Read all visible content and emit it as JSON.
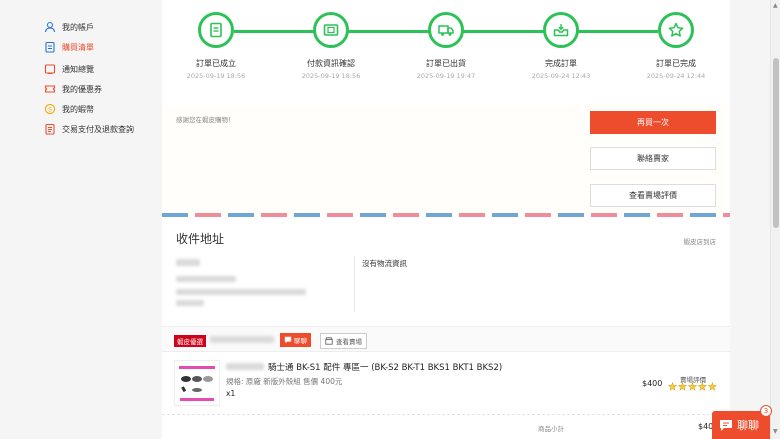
{
  "sidebar": {
    "items": [
      {
        "label": "我的帳戶",
        "icon": "user-icon"
      },
      {
        "label": "購買清單",
        "icon": "clipboard-icon",
        "active": true
      },
      {
        "label": "通知總覽",
        "icon": "bell-icon"
      },
      {
        "label": "我的優惠券",
        "icon": "ticket-icon"
      },
      {
        "label": "我的蝦幣",
        "icon": "coin-icon"
      },
      {
        "label": "交易支付及退款查詢",
        "icon": "document-icon"
      }
    ]
  },
  "steps": [
    {
      "label": "訂單已成立",
      "time": "2025-09-19 18:56",
      "icon": "receipt-icon"
    },
    {
      "label": "付款資訊確認",
      "time": "2025-09-19 18:56",
      "icon": "payment-icon"
    },
    {
      "label": "訂單已出貨",
      "time": "2025-09-19 19:47",
      "icon": "truck-icon"
    },
    {
      "label": "完成訂單",
      "time": "2025-09-24 12:43",
      "icon": "inbox-icon"
    },
    {
      "label": "訂單已完成",
      "time": "2025-09-24 12:44",
      "icon": "star-icon"
    }
  ],
  "thanks_text": "感謝您在蝦皮購物！",
  "buttons": {
    "buy_again": "再買一次",
    "contact_seller": "聯絡賣家",
    "view_rating": "查看賣場評價"
  },
  "address": {
    "title": "收件地址",
    "note": "蝦皮店到店",
    "logistics": "沒有物流資訊"
  },
  "shop": {
    "badge": "蝦皮優選",
    "chat_label": "聊聊",
    "view_shop_label": "查看賣場"
  },
  "product": {
    "name": "騎士通 BK-S1 配件 專區一 (BK-S2 BK-T1 BKS1 BKT1 BKS2)",
    "spec": "規格: 原廠 新版外殼組 售價 400元",
    "qty": "x1",
    "price": "$400",
    "rating_label": "賣場評價",
    "rating_stars": 5
  },
  "subtotal": {
    "label": "商品小計",
    "value": "$40"
  },
  "chat_float": {
    "label": "聊聊",
    "count": "3"
  },
  "colors": {
    "accent": "#ee4d2d",
    "step_green": "#2dc258"
  }
}
